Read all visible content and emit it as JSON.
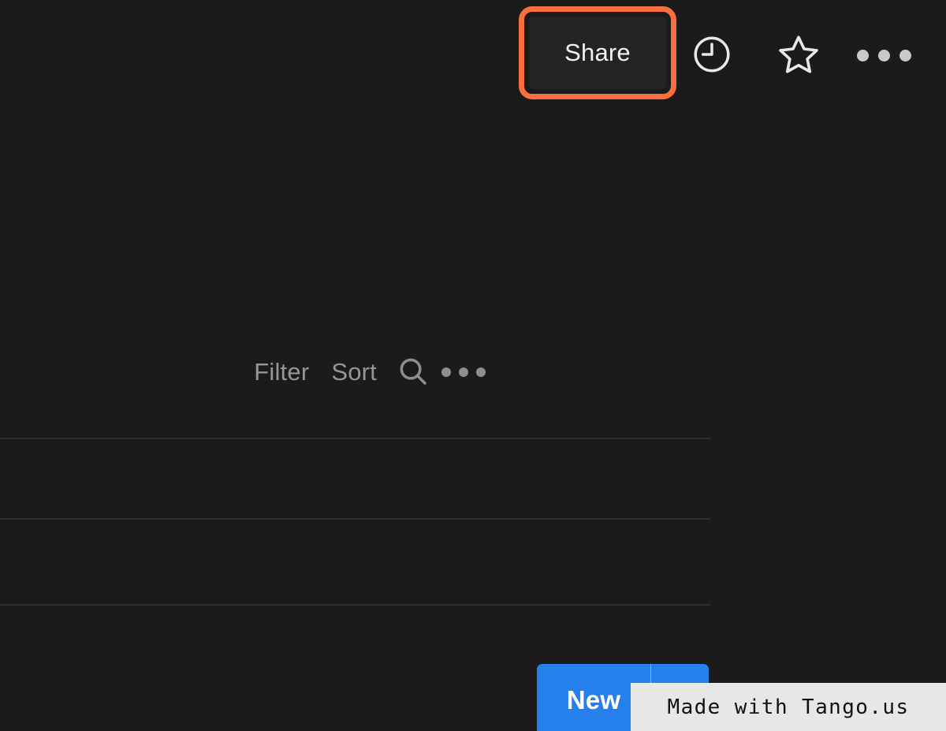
{
  "app": {
    "theme": "dark",
    "background_color": "#1b1b1b",
    "accent_blue": "#2680eb",
    "highlight_orange": "#f9703e"
  },
  "top_bar": {
    "share_button": {
      "label": "Share",
      "highlighted": true,
      "highlight_color": "#f9703e"
    },
    "icons": [
      {
        "name": "version-history-icon",
        "title": "Version history"
      },
      {
        "name": "favorite-star-icon",
        "title": "Add to favorites"
      },
      {
        "name": "more-options-icon",
        "title": "More options"
      }
    ]
  },
  "list_toolbar": {
    "filter_label": "Filter",
    "sort_label": "Sort",
    "search_icon_title": "Search",
    "more_icon_title": "More",
    "new_button": {
      "label": "New",
      "caret_title": "New item options",
      "color": "#2680eb"
    }
  },
  "list": {
    "divider_color": "#2f2f2f",
    "divider_positions": [
      25,
      127,
      236
    ],
    "rows": [
      {
        "id": "row-1"
      },
      {
        "id": "row-2"
      },
      {
        "id": "row-3"
      },
      {
        "id": "row-4"
      }
    ]
  },
  "watermark": {
    "text": "Made with Tango.us",
    "background_color": "#e7e7e7",
    "text_color": "#14100f"
  }
}
